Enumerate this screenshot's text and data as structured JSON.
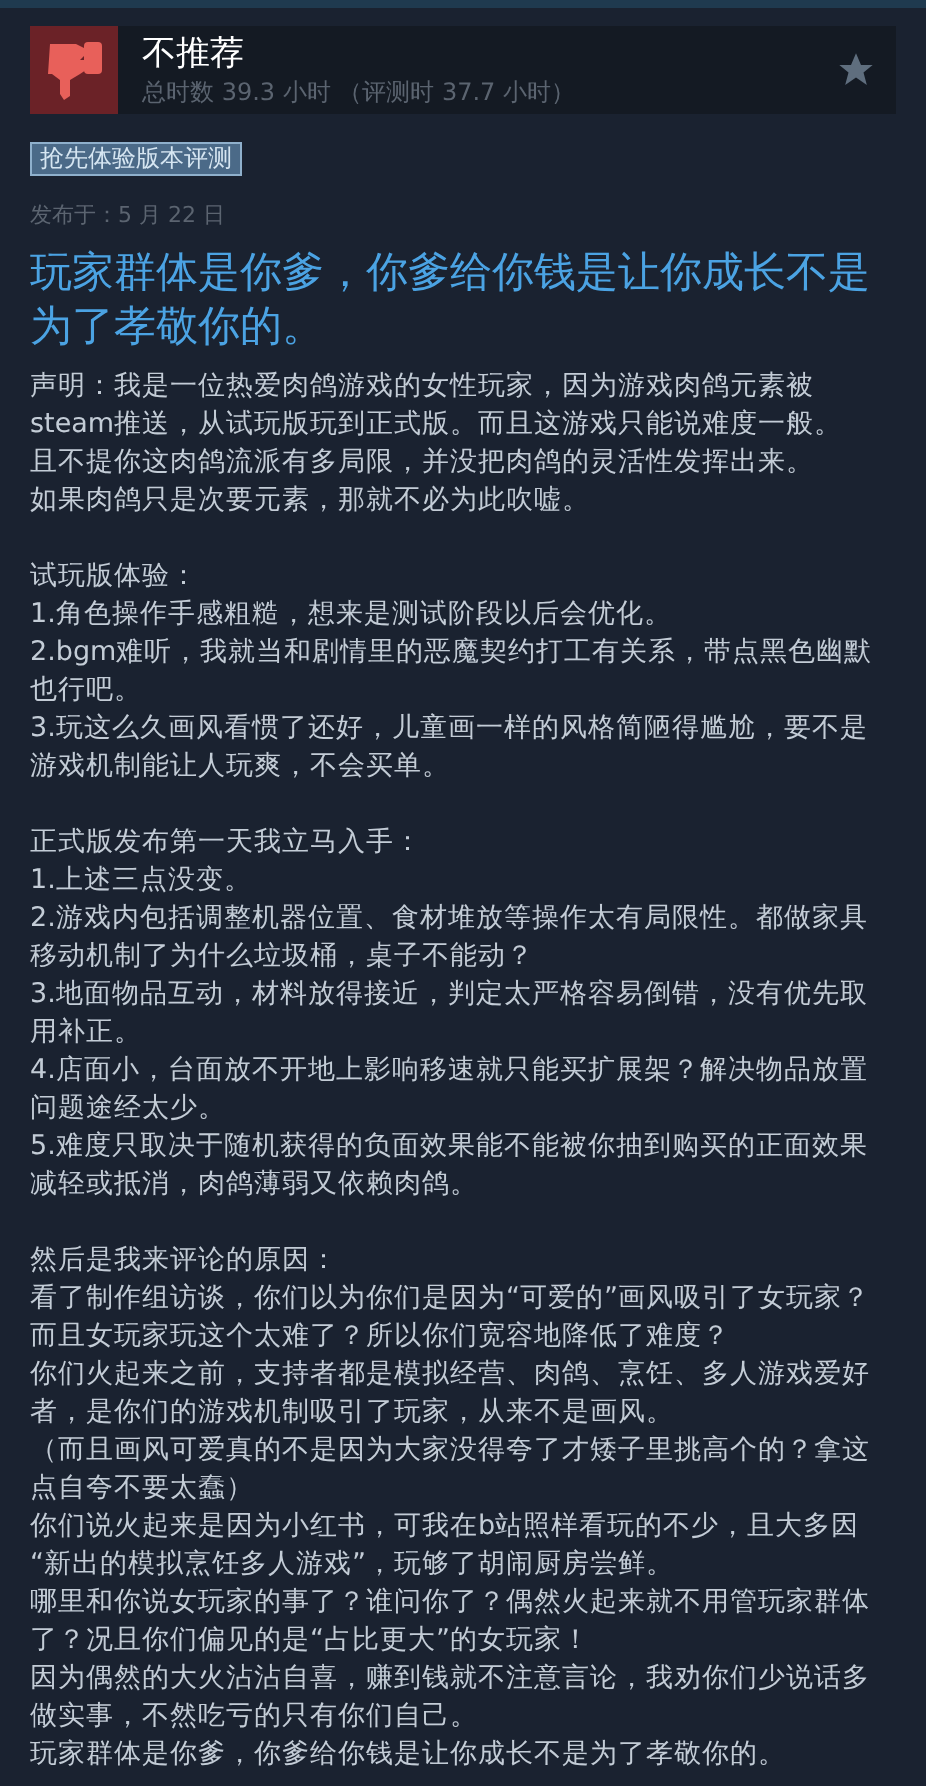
{
  "review": {
    "verdict": "不推荐",
    "hours": "总时数 39.3 小时 （评测时 37.7 小时）"
  },
  "badge": "抢先体验版本评测",
  "posted": "发布于：5 月 22 日",
  "headline": "玩家群体是你爹，你爹给你钱是让你成长不是为了孝敬你的。",
  "paragraphs": [
    [
      "声明：我是一位热爱肉鸽游戏的女性玩家，因为游戏肉鸽元素被",
      "steam推送，从试玩版玩到正式版。而且这游戏只能说难度一般。",
      "且不提你这肉鸽流派有多局限，并没把肉鸽的灵活性发挥出来。",
      "如果肉鸽只是次要元素，那就不必为此吹嘘。"
    ],
    [
      "试玩版体验：",
      "1.角色操作手感粗糙，想来是测试阶段以后会优化。",
      "2.bgm难听，我就当和剧情里的恶魔契约打工有关系，带点黑色幽默",
      "也行吧。",
      "3.玩这么久画风看惯了还好，儿童画一样的风格简陋得尴尬，要不是",
      "游戏机制能让人玩爽，不会买单。"
    ],
    [
      "正式版发布第一天我立马入手：",
      "1.上述三点没变。",
      "2.游戏内包括调整机器位置、食材堆放等操作太有局限性。都做家具",
      "移动机制了为什么垃圾桶，桌子不能动？",
      "3.地面物品互动，材料放得接近，判定太严格容易倒错，没有优先取",
      "用补正。",
      "4.店面小，台面放不开地上影响移速就只能买扩展架？解决物品放置",
      "问题途经太少。",
      "5.难度只取决于随机获得的负面效果能不能被你抽到购买的正面效果",
      "减轻或抵消，肉鸽薄弱又依赖肉鸽。"
    ],
    [
      "然后是我来评论的原因：",
      "看了制作组访谈，你们以为你们是因为“可爱的”画风吸引了女玩家？",
      "而且女玩家玩这个太难了？所以你们宽容地降低了难度？",
      "你们火起来之前，支持者都是模拟经营、肉鸽、烹饪、多人游戏爱好",
      "者，是你们的游戏机制吸引了玩家，从来不是画风。",
      "（而且画风可爱真的不是因为大家没得夸了才矮子里挑高个的？拿这",
      "点自夸不要太蠢）",
      "你们说火起来是因为小红书，可我在b站照样看玩的不少，且大多因",
      "“新出的模拟烹饪多人游戏”，玩够了胡闹厨房尝鲜。",
      "哪里和你说女玩家的事了？谁问你了？偶然火起来就不用管玩家群体",
      "了？况且你们偏见的是“占比更大”的女玩家！",
      "因为偶然的大火沾沾自喜，赚到钱就不注意言论，我劝你们少说话多",
      "做实事，不然吃亏的只有你们自己。",
      "玩家群体是你爹，你爹给你钱是让你成长不是为了孝敬你的。"
    ]
  ]
}
